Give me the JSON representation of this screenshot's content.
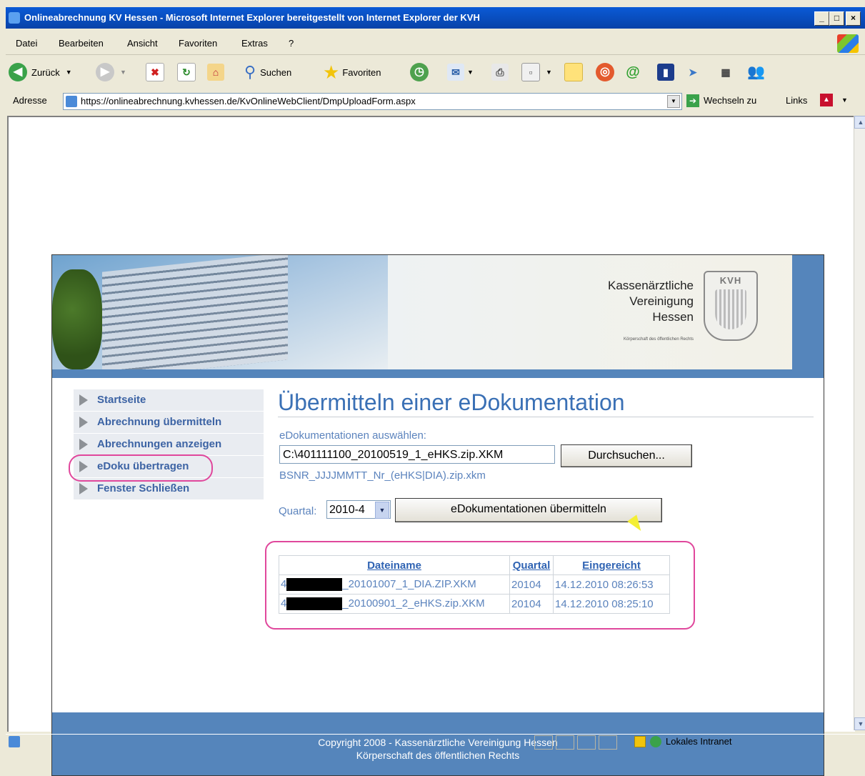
{
  "window": {
    "title": "Onlineabrechnung KV Hessen - Microsoft Internet Explorer bereitgestellt von Internet Explorer der KVH"
  },
  "menu": [
    "Datei",
    "Bearbeiten",
    "Ansicht",
    "Favoriten",
    "Extras",
    "?"
  ],
  "toolbar": {
    "back": "Zurück",
    "search": "Suchen",
    "favorites": "Favoriten"
  },
  "address": {
    "label": "Adresse",
    "url": "https://onlineabrechnung.kvhessen.de/KvOnlineWebClient/DmpUploadForm.aspx",
    "go": "Wechseln zu",
    "links": "Links"
  },
  "status": {
    "zone": "Lokales Intranet"
  },
  "banner": {
    "logo_lines": [
      "Kassenärztliche",
      "Vereinigung",
      "Hessen"
    ],
    "logo_sub": "Körperschaft des öffentlichen Rechts",
    "seal_text": "KVH"
  },
  "nav": {
    "items": [
      "Startseite",
      "Abrechnung übermitteln",
      "Abrechnungen anzeigen",
      "eDoku übertragen",
      "Fenster Schließen"
    ]
  },
  "main": {
    "title": "Übermitteln einer eDokumentation",
    "select_label": "eDokumentationen auswählen:",
    "file_value": "C:\\401111100_20100519_1_eHKS.zip.XKM",
    "browse_label": "Durchsuchen...",
    "pattern_hint": "BSNR_JJJJMMTT_Nr_(eHKS|DIA).zip.xkm",
    "quartal_label": "Quartal:",
    "quartal_value": "2010-4",
    "submit_label": "eDokumentationen übermitteln"
  },
  "table": {
    "headers": [
      "Dateiname",
      "Quartal",
      "Eingereicht"
    ],
    "rows": [
      {
        "file_prefix": "4",
        "file_suffix": "_20101007_1_DIA.ZIP.XKM",
        "quartal": "20104",
        "submitted": "14.12.2010 08:26:53"
      },
      {
        "file_prefix": "4",
        "file_suffix": "_20100901_2_eHKS.zip.XKM",
        "quartal": "20104",
        "submitted": "14.12.2010 08:25:10"
      }
    ]
  },
  "footer": {
    "line1": "Copyright 2008 - Kassenärztliche Vereinigung Hessen",
    "line2": "Körperschaft des öffentlichen Rechts"
  },
  "colors": {
    "accent_blue": "#3a70b5",
    "banner_blue": "#5585bb",
    "highlight_pink": "#e0479c",
    "nav_text": "#3c63a4"
  }
}
